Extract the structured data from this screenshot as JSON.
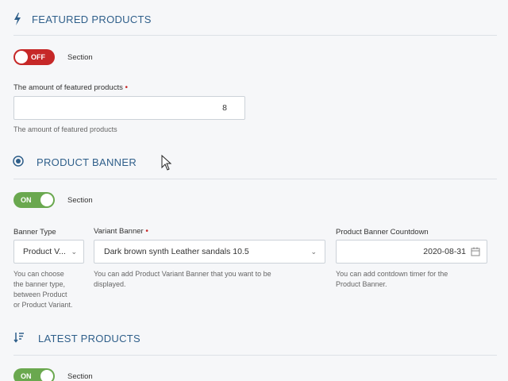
{
  "featured": {
    "title": "FEATURED PRODUCTS",
    "icon": "bolt-icon",
    "toggle_label": "OFF",
    "section_label": "Section",
    "amount_label": "The amount of featured products",
    "amount_value": "8",
    "amount_help": "The amount of featured products"
  },
  "banner": {
    "title": "PRODUCT BANNER",
    "icon": "target-icon",
    "toggle_label": "ON",
    "section_label": "Section",
    "type_label": "Banner Type",
    "type_value": "Product V...",
    "type_help": [
      "You can choose",
      "the banner type,",
      "between Product",
      "or Product Variant."
    ],
    "variant_label": "Variant Banner",
    "variant_value": "Dark brown synth Leather sandals 10.5",
    "variant_help": [
      "You can add Product Variant Banner that you want to be",
      "displayed."
    ],
    "countdown_label": "Product Banner Countdown",
    "countdown_value": "2020-08-31",
    "countdown_help": [
      "You can add contdown timer for the",
      "Product Banner."
    ]
  },
  "latest": {
    "title": "LATEST PRODUCTS",
    "icon": "sort-icon",
    "toggle_label": "ON",
    "section_label": "Section"
  },
  "colors": {
    "accent": "#2f5f8a",
    "off": "#c62828",
    "on": "#6aa84f"
  }
}
